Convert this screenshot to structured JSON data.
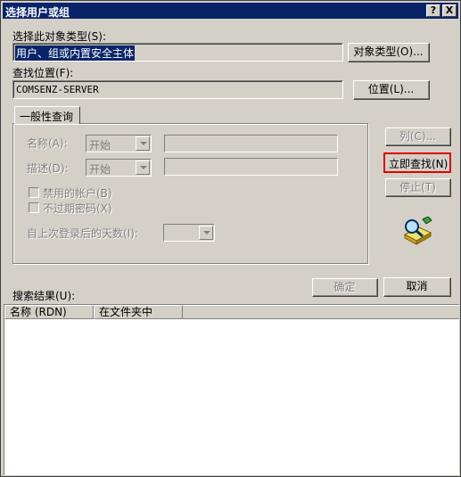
{
  "window": {
    "title": "选择用户或组",
    "help_btn": "?",
    "close_btn": "X"
  },
  "object_type": {
    "label": "选择此对象类型(S):",
    "value": "用户、组或内置安全主体",
    "button": "对象类型(O)..."
  },
  "location": {
    "label": "查找位置(F):",
    "value": "COMSENZ-SERVER",
    "button": "位置(L)..."
  },
  "tab": {
    "label": "一般性查询"
  },
  "query": {
    "name_label": "名称(A):",
    "name_mode": "开始",
    "name_value": "",
    "desc_label": "描述(D):",
    "desc_mode": "开始",
    "desc_value": "",
    "disabled_accounts_label": "禁用的帐户(B)",
    "no_expire_label": "不过期密码(X)",
    "days_label": "自上次登录后的天数(I):",
    "days_value": ""
  },
  "side_buttons": {
    "columns": "列(C)...",
    "find_now": "立即查找(N)",
    "stop": "停止(T)"
  },
  "dialog_buttons": {
    "ok": "确定",
    "cancel": "取消"
  },
  "results": {
    "label": "搜索结果(U):",
    "columns": [
      "名称 (RDN)",
      "在文件夹中"
    ],
    "rows": []
  },
  "colors": {
    "title_bg": "#0a246a",
    "face": "#d4d0c8",
    "selection": "#0a246a",
    "highlight_border": "#e00000"
  },
  "icons": [
    "help-icon",
    "close-icon",
    "search-folder-icon"
  ]
}
